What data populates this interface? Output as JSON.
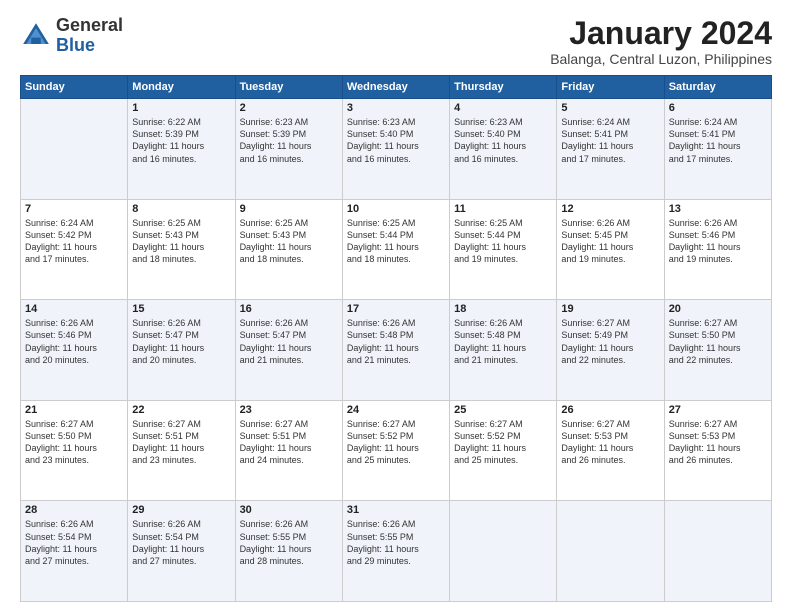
{
  "logo": {
    "general": "General",
    "blue": "Blue"
  },
  "title": {
    "month": "January 2024",
    "location": "Balanga, Central Luzon, Philippines"
  },
  "days_header": [
    "Sunday",
    "Monday",
    "Tuesday",
    "Wednesday",
    "Thursday",
    "Friday",
    "Saturday"
  ],
  "weeks": [
    [
      {
        "day": "",
        "info": ""
      },
      {
        "day": "1",
        "info": "Sunrise: 6:22 AM\nSunset: 5:39 PM\nDaylight: 11 hours\nand 16 minutes."
      },
      {
        "day": "2",
        "info": "Sunrise: 6:23 AM\nSunset: 5:39 PM\nDaylight: 11 hours\nand 16 minutes."
      },
      {
        "day": "3",
        "info": "Sunrise: 6:23 AM\nSunset: 5:40 PM\nDaylight: 11 hours\nand 16 minutes."
      },
      {
        "day": "4",
        "info": "Sunrise: 6:23 AM\nSunset: 5:40 PM\nDaylight: 11 hours\nand 16 minutes."
      },
      {
        "day": "5",
        "info": "Sunrise: 6:24 AM\nSunset: 5:41 PM\nDaylight: 11 hours\nand 17 minutes."
      },
      {
        "day": "6",
        "info": "Sunrise: 6:24 AM\nSunset: 5:41 PM\nDaylight: 11 hours\nand 17 minutes."
      }
    ],
    [
      {
        "day": "7",
        "info": "Sunrise: 6:24 AM\nSunset: 5:42 PM\nDaylight: 11 hours\nand 17 minutes."
      },
      {
        "day": "8",
        "info": "Sunrise: 6:25 AM\nSunset: 5:43 PM\nDaylight: 11 hours\nand 18 minutes."
      },
      {
        "day": "9",
        "info": "Sunrise: 6:25 AM\nSunset: 5:43 PM\nDaylight: 11 hours\nand 18 minutes."
      },
      {
        "day": "10",
        "info": "Sunrise: 6:25 AM\nSunset: 5:44 PM\nDaylight: 11 hours\nand 18 minutes."
      },
      {
        "day": "11",
        "info": "Sunrise: 6:25 AM\nSunset: 5:44 PM\nDaylight: 11 hours\nand 19 minutes."
      },
      {
        "day": "12",
        "info": "Sunrise: 6:26 AM\nSunset: 5:45 PM\nDaylight: 11 hours\nand 19 minutes."
      },
      {
        "day": "13",
        "info": "Sunrise: 6:26 AM\nSunset: 5:46 PM\nDaylight: 11 hours\nand 19 minutes."
      }
    ],
    [
      {
        "day": "14",
        "info": "Sunrise: 6:26 AM\nSunset: 5:46 PM\nDaylight: 11 hours\nand 20 minutes."
      },
      {
        "day": "15",
        "info": "Sunrise: 6:26 AM\nSunset: 5:47 PM\nDaylight: 11 hours\nand 20 minutes."
      },
      {
        "day": "16",
        "info": "Sunrise: 6:26 AM\nSunset: 5:47 PM\nDaylight: 11 hours\nand 21 minutes."
      },
      {
        "day": "17",
        "info": "Sunrise: 6:26 AM\nSunset: 5:48 PM\nDaylight: 11 hours\nand 21 minutes."
      },
      {
        "day": "18",
        "info": "Sunrise: 6:26 AM\nSunset: 5:48 PM\nDaylight: 11 hours\nand 21 minutes."
      },
      {
        "day": "19",
        "info": "Sunrise: 6:27 AM\nSunset: 5:49 PM\nDaylight: 11 hours\nand 22 minutes."
      },
      {
        "day": "20",
        "info": "Sunrise: 6:27 AM\nSunset: 5:50 PM\nDaylight: 11 hours\nand 22 minutes."
      }
    ],
    [
      {
        "day": "21",
        "info": "Sunrise: 6:27 AM\nSunset: 5:50 PM\nDaylight: 11 hours\nand 23 minutes."
      },
      {
        "day": "22",
        "info": "Sunrise: 6:27 AM\nSunset: 5:51 PM\nDaylight: 11 hours\nand 23 minutes."
      },
      {
        "day": "23",
        "info": "Sunrise: 6:27 AM\nSunset: 5:51 PM\nDaylight: 11 hours\nand 24 minutes."
      },
      {
        "day": "24",
        "info": "Sunrise: 6:27 AM\nSunset: 5:52 PM\nDaylight: 11 hours\nand 25 minutes."
      },
      {
        "day": "25",
        "info": "Sunrise: 6:27 AM\nSunset: 5:52 PM\nDaylight: 11 hours\nand 25 minutes."
      },
      {
        "day": "26",
        "info": "Sunrise: 6:27 AM\nSunset: 5:53 PM\nDaylight: 11 hours\nand 26 minutes."
      },
      {
        "day": "27",
        "info": "Sunrise: 6:27 AM\nSunset: 5:53 PM\nDaylight: 11 hours\nand 26 minutes."
      }
    ],
    [
      {
        "day": "28",
        "info": "Sunrise: 6:26 AM\nSunset: 5:54 PM\nDaylight: 11 hours\nand 27 minutes."
      },
      {
        "day": "29",
        "info": "Sunrise: 6:26 AM\nSunset: 5:54 PM\nDaylight: 11 hours\nand 27 minutes."
      },
      {
        "day": "30",
        "info": "Sunrise: 6:26 AM\nSunset: 5:55 PM\nDaylight: 11 hours\nand 28 minutes."
      },
      {
        "day": "31",
        "info": "Sunrise: 6:26 AM\nSunset: 5:55 PM\nDaylight: 11 hours\nand 29 minutes."
      },
      {
        "day": "",
        "info": ""
      },
      {
        "day": "",
        "info": ""
      },
      {
        "day": "",
        "info": ""
      }
    ]
  ]
}
